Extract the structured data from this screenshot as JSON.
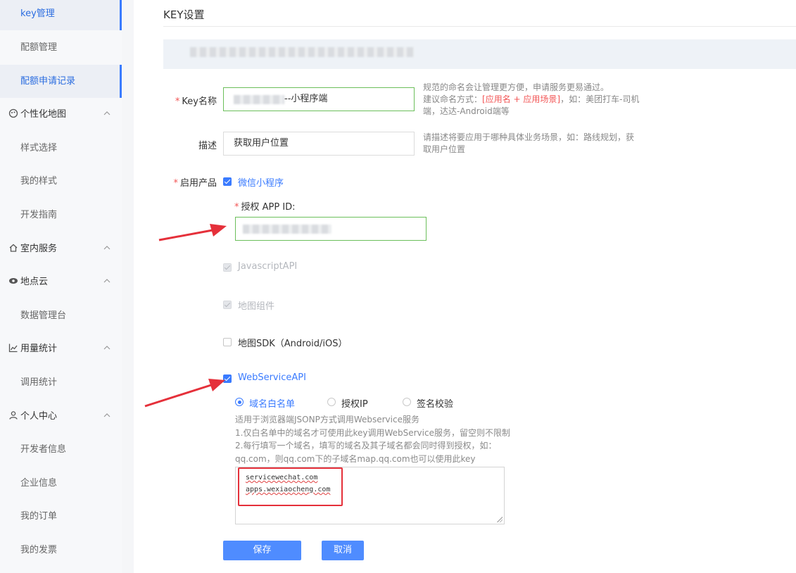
{
  "sidebar": {
    "items": [
      {
        "type": "sub",
        "label": "key管理",
        "active": true
      },
      {
        "type": "sub",
        "label": "配额管理"
      },
      {
        "type": "sub",
        "label": "配额申请记录",
        "active": true
      },
      {
        "type": "group",
        "label": "个性化地图",
        "icon": "palette-icon"
      },
      {
        "type": "sub",
        "label": "样式选择"
      },
      {
        "type": "sub",
        "label": "我的样式"
      },
      {
        "type": "sub",
        "label": "开发指南"
      },
      {
        "type": "group",
        "label": "室内服务",
        "icon": "home-icon"
      },
      {
        "type": "group",
        "label": "地点云",
        "icon": "eye-icon"
      },
      {
        "type": "sub",
        "label": "数据管理台"
      },
      {
        "type": "group",
        "label": "用量统计",
        "icon": "chart-icon"
      },
      {
        "type": "sub",
        "label": "调用统计"
      },
      {
        "type": "group",
        "label": "个人中心",
        "icon": "user-icon"
      },
      {
        "type": "sub",
        "label": "开发者信息"
      },
      {
        "type": "sub",
        "label": "企业信息"
      },
      {
        "type": "sub",
        "label": "我的订单"
      },
      {
        "type": "sub",
        "label": "我的发票"
      }
    ],
    "chevron": "^"
  },
  "page": {
    "title": "KEY设置"
  },
  "form": {
    "required_mark": "*",
    "key_name": {
      "label": "Key名称",
      "value_visible": "--小程序端",
      "hint_line1": "规范的命名会让管理更方便，申请服务更易通过。",
      "hint_line2_prefix": "建议命名方式：",
      "hint_line2_red": "[应用名 + 应用场景]",
      "hint_line2_suffix": "，如：美团打车-司机",
      "hint_line3": "端，达达-Android端等"
    },
    "desc": {
      "label": "描述",
      "value": "获取用户位置",
      "hint_line1": "请描述将要应用于哪种具体业务场景，如：路线规划，获",
      "hint_line2": "取用户位置"
    },
    "products": {
      "label": "启用产品",
      "wechat": "微信小程序",
      "appid_label": "授权 APP ID:",
      "javascript_api": "JavascriptAPI",
      "map_component": "地图组件",
      "map_sdk": "地图SDK（Android/iOS）",
      "webservice_api": "WebServiceAPI",
      "radios": [
        "域名白名单",
        "授权IP",
        "签名校验"
      ],
      "ws_desc": [
        "适用于浏览器端JSONP方式调用Webservice服务",
        "1.仅白名单中的域名才可使用此key调用WebService服务，留空则不限制",
        "2.每行填写一个域名，填写的域名及其子域名都会同时得到授权，如：",
        "qq.com，则qq.com下的子域名map.qq.com也可以使用此key"
      ],
      "domains": [
        "servicewechat.com",
        "apps.wexiaocheng.com"
      ]
    },
    "save": "保存",
    "cancel": "取消"
  },
  "colors": {
    "accent": "#3a7bff",
    "required": "#f25555",
    "annotation": "#e5303a",
    "valid_border": "#6cbf5b"
  }
}
